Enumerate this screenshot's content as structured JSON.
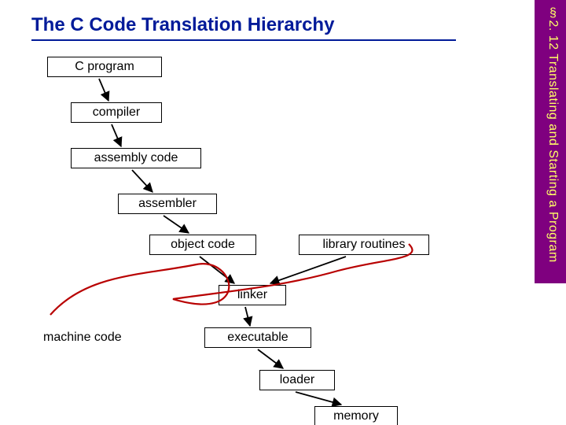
{
  "title": "The C Code Translation Hierarchy",
  "sidebar": "§2. 12 Translating and Starting a Program",
  "nodes": {
    "c_program": "C program",
    "compiler": "compiler",
    "assembly_code": "assembly code",
    "assembler": "assembler",
    "object_code": "object code",
    "library_routines": "library routines",
    "linker": "linker",
    "executable": "executable",
    "loader": "loader",
    "memory": "memory",
    "machine_code": "machine code"
  }
}
